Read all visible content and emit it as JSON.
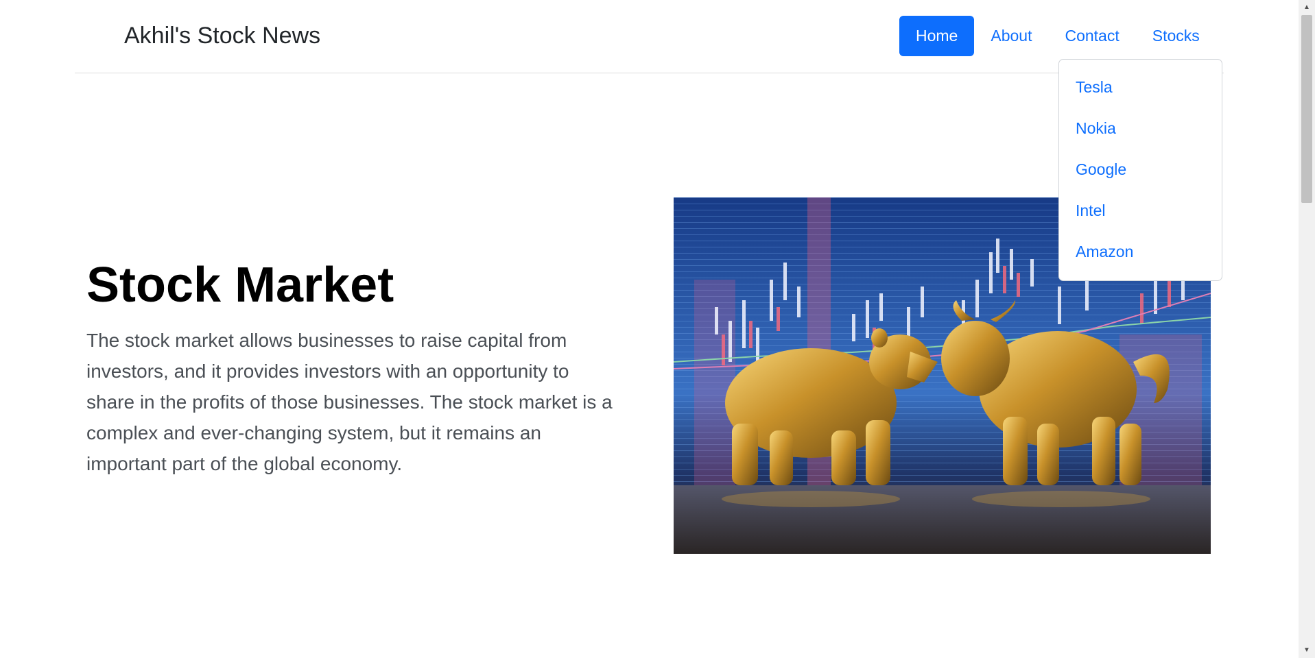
{
  "header": {
    "brand": "Akhil's Stock News",
    "nav": [
      {
        "label": "Home",
        "active": true
      },
      {
        "label": "About",
        "active": false
      },
      {
        "label": "Contact",
        "active": false
      },
      {
        "label": "Stocks",
        "active": false
      }
    ]
  },
  "stocks_dropdown": {
    "items": [
      "Tesla",
      "Nokia",
      "Google",
      "Intel",
      "Amazon"
    ]
  },
  "hero": {
    "title": "Stock Market",
    "text": "The stock market allows businesses to raise capital from investors, and it provides investors with an opportunity to share in the profits of those businesses. The stock market is a complex and ever-changing system, but it remains an important part of the global economy."
  },
  "colors": {
    "accent": "#0d6efd",
    "title": "#000000",
    "body_text": "#4a4f55"
  },
  "icons": {
    "scroll_up": "triangle-up",
    "scroll_down": "triangle-down"
  }
}
